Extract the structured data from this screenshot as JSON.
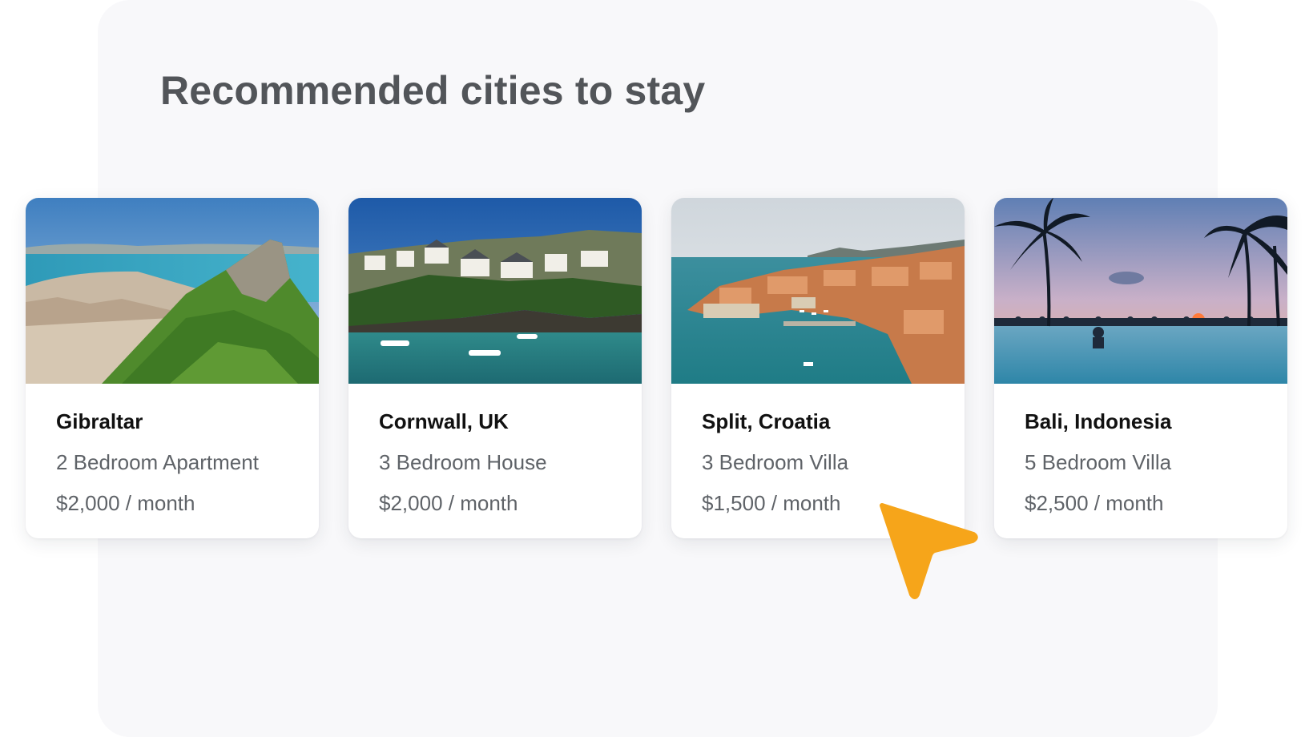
{
  "section": {
    "title": "Recommended cities to stay"
  },
  "cards": [
    {
      "city": "Gibraltar",
      "property": "2 Bedroom Apartment",
      "price": "$2,000 / month",
      "image": "gibraltar-rock-photo"
    },
    {
      "city": "Cornwall, UK",
      "property": "3 Bedroom House",
      "price": "$2,000 / month",
      "image": "cornwall-harbour-photo"
    },
    {
      "city": "Split, Croatia",
      "property": "3 Bedroom Villa",
      "price": "$1,500 / month",
      "image": "split-old-town-photo"
    },
    {
      "city": "Bali, Indonesia",
      "property": "5 Bedroom Villa",
      "price": "$2,500 / month",
      "image": "bali-infinity-pool-photo"
    }
  ],
  "cursor": {
    "icon": "pointer-cursor-icon",
    "color": "#f6a51a"
  }
}
